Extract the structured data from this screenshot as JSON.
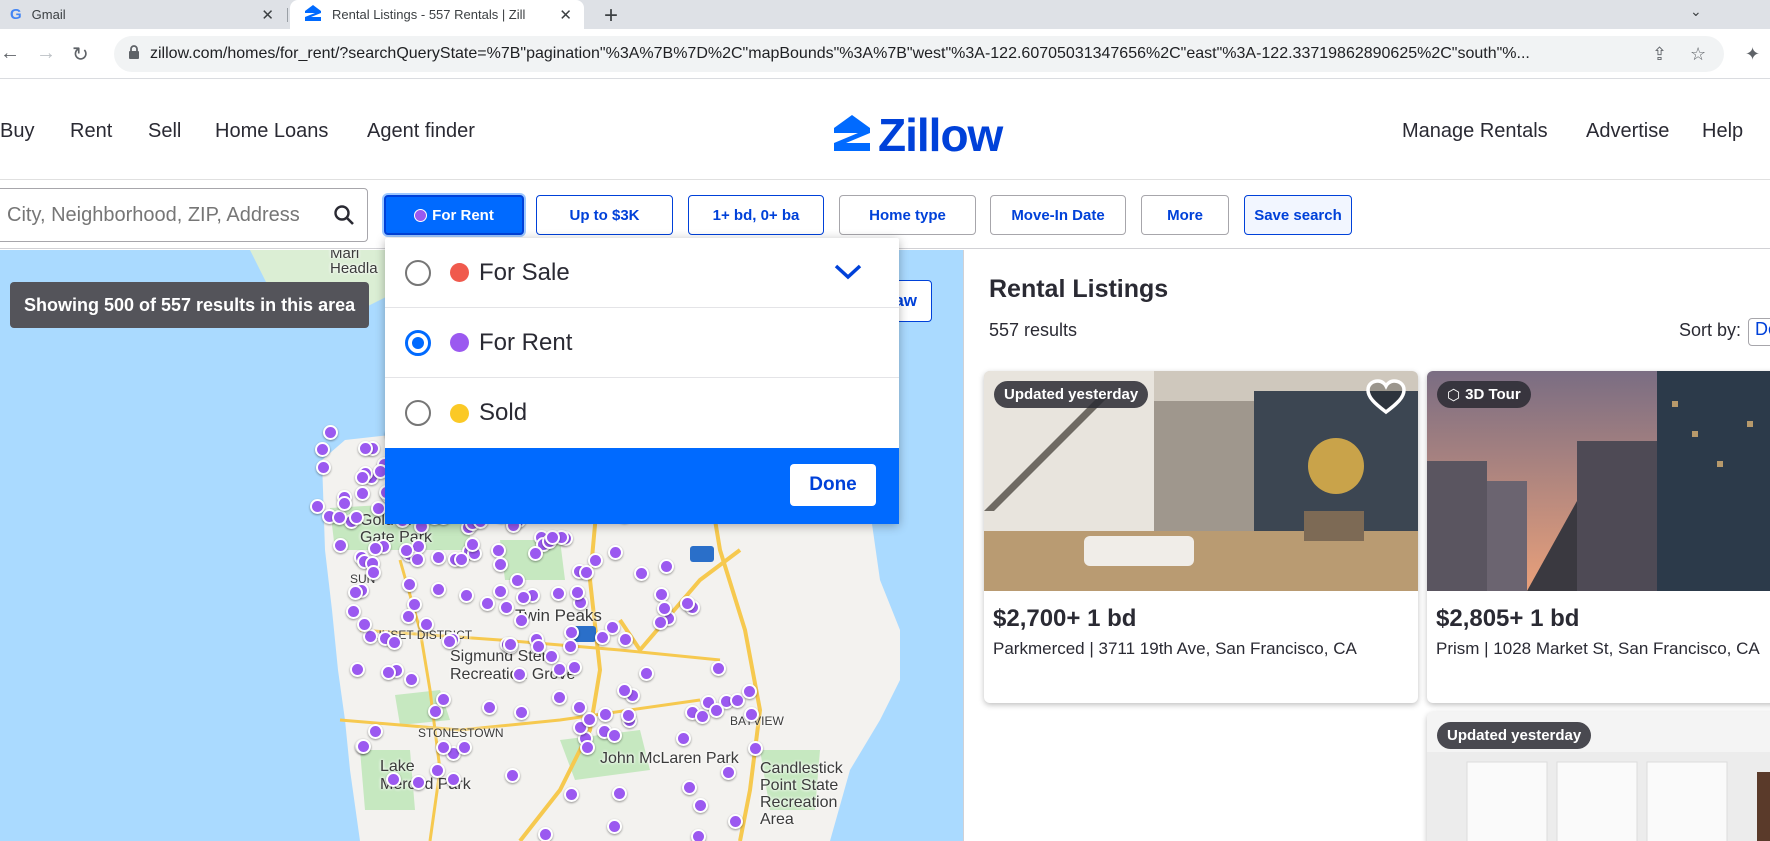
{
  "browser": {
    "tabs": [
      {
        "title": "Gmail"
      },
      {
        "title": "Rental Listings - 557 Rentals | Zill"
      }
    ],
    "url": "zillow.com/homes/for_rent/?searchQueryState=%7B\"pagination\"%3A%7B%7D%2C\"mapBounds\"%3A%7B\"west\"%3A-122.60705031347656%2C\"east\"%3A-122.33719862890625%2C\"south\"%..."
  },
  "header": {
    "nav_left": [
      "Buy",
      "Rent",
      "Sell",
      "Home Loans",
      "Agent finder"
    ],
    "logo": "Zillow",
    "nav_right": [
      "Manage Rentals",
      "Advertise",
      "Help"
    ]
  },
  "filters": {
    "search_placeholder": "City, Neighborhood, ZIP, Address",
    "listing_type": "For Rent",
    "price": "Up to $3K",
    "beds_baths": "1+ bd, 0+ ba",
    "home_type": "Home type",
    "move_in": "Move-In Date",
    "more": "More",
    "save": "Save search"
  },
  "dropdown": {
    "options": [
      {
        "label": "For Sale",
        "color": "#f05a4d",
        "checked": false
      },
      {
        "label": "For Rent",
        "color": "#9b59f0",
        "checked": true
      },
      {
        "label": "Sold",
        "color": "#fbc926",
        "checked": false
      }
    ],
    "done": "Done"
  },
  "map": {
    "showing": "Showing 500 of 557 results in this area",
    "draw": "aw",
    "labels": {
      "golden_gate_park": "Golden\nGate Park",
      "sunset": "SUNSET DISTRICT",
      "twin_peaks": "Twin Peaks",
      "stern_grove": "Sigmund Stern\nRecreation Grove",
      "stonestown": "STONESTOWN",
      "lake_merced": "Lake\nMerced Park",
      "mclaren": "John McLaren Park",
      "bayview": "BAYVIEW",
      "candlestick": "Candlestick\nPoint State\nRecreation\nArea",
      "marin": "Mari\nHeadla",
      "sun": "SUN"
    }
  },
  "listings": {
    "title": "Rental Listings",
    "count": "557 results",
    "sort_label": "Sort by:",
    "sort_value": "De",
    "cards": [
      {
        "badge": "Updated yesterday",
        "price": "$2,700+ 1 bd",
        "address": "Parkmerced | 3711 19th Ave, San Francisco, CA"
      },
      {
        "badge": "3D Tour",
        "price": "$2,805+ 1 bd",
        "address": "Prism | 1028 Market St, San Francisco, CA"
      },
      {
        "badge": "Updated yesterday",
        "price": "",
        "address": ""
      }
    ]
  }
}
